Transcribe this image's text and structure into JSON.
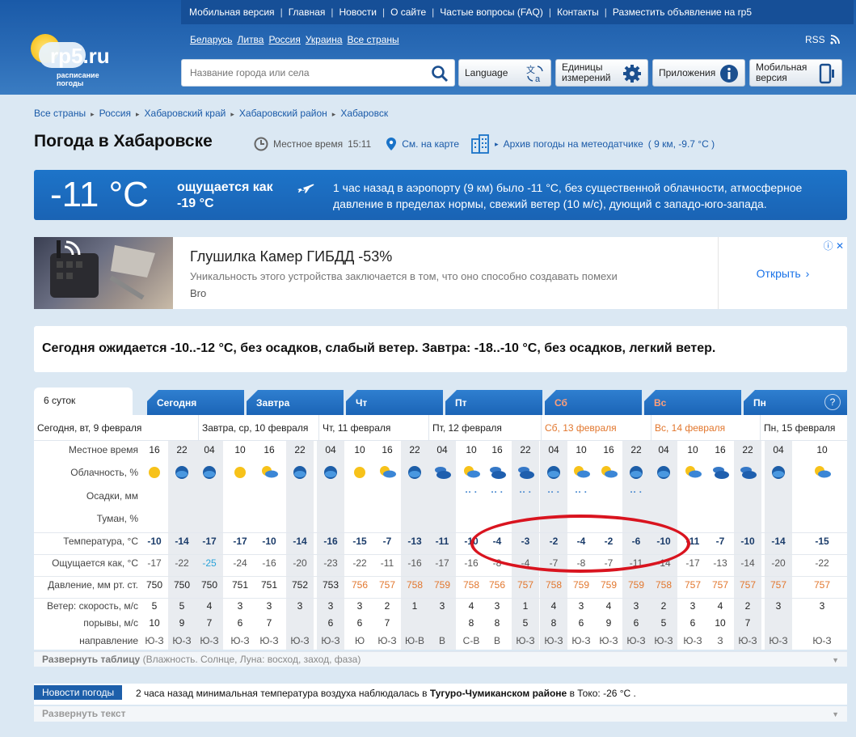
{
  "header": {
    "logo_name": "rp5.ru",
    "logo_sub": "расписание погоды",
    "nav": [
      "Мобильная версия",
      "Главная",
      "Новости",
      "О сайте",
      "Частые вопросы (FAQ)",
      "Контакты",
      "Разместить объявление на rp5"
    ],
    "countries": [
      "Беларусь",
      "Литва",
      "Россия",
      "Украина",
      "Все страны"
    ],
    "rss": "RSS",
    "search_placeholder": "Название города или села",
    "btn_language": "Language",
    "btn_units": "Единицы измерений",
    "btn_apps": "Приложения",
    "btn_mobile": "Мобильная версия"
  },
  "breadcrumbs": [
    "Все страны",
    "Россия",
    "Хабаровский край",
    "Хабаровский район",
    "Хабаровск"
  ],
  "page_title": "Погода в Хабаровске",
  "local_time_label": "Местное время",
  "local_time": "15:11",
  "map_link": "См. на карте",
  "archive_link": "Архив погоды на метеодатчике",
  "archive_note": "( 9 км, -9.7 °C )",
  "current": {
    "temp": "-11 °C",
    "feels": "ощущается как -19 °C",
    "desc": "1 час назад в аэропорту (9 км) было -11 °C, без существенной облачности, атмосферное давление в пределах нормы, свежий ветер (10 м/с), дующий с западо-юго-запада."
  },
  "ad": {
    "title": "Глушилка Камер ГИБДД -53%",
    "sub": "Уникальность этого устройства заключается в том, что оно способно создавать помехи",
    "source": "Bro",
    "open": "Открыть"
  },
  "forecast_text": "Сегодня ожидается -10..-12 °C, без осадков, слабый ветер. Завтра: -18..-10 °C, без осадков, легкий ветер.",
  "tabs": [
    {
      "label": "6 суток",
      "active": true,
      "weekend": false
    },
    {
      "label": "Сегодня",
      "active": false,
      "weekend": false
    },
    {
      "label": "Завтра",
      "active": false,
      "weekend": false
    },
    {
      "label": "Чт",
      "active": false,
      "weekend": false
    },
    {
      "label": "Пт",
      "active": false,
      "weekend": false
    },
    {
      "label": "Сб",
      "active": false,
      "weekend": true
    },
    {
      "label": "Вс",
      "active": false,
      "weekend": true
    },
    {
      "label": "Пн",
      "active": false,
      "weekend": false
    }
  ],
  "help": "?",
  "days": [
    {
      "label": "Сегодня, вт, 9 февраля",
      "cols": 2,
      "weekend": false
    },
    {
      "label": "Завтра, ср, 10 февраля",
      "cols": 4,
      "weekend": false
    },
    {
      "label": "Чт, 11 февраля",
      "cols": 4,
      "weekend": false
    },
    {
      "label": "Пт, 12 февраля",
      "cols": 4,
      "weekend": false
    },
    {
      "label": "Сб, 13 февраля",
      "cols": 4,
      "weekend": true
    },
    {
      "label": "Вс, 14 февраля",
      "cols": 4,
      "weekend": true
    },
    {
      "label": "Пн, 15 февраля",
      "cols": 2,
      "weekend": false
    }
  ],
  "row_labels": [
    "Местное время",
    "Облачность, %",
    "Осадки, мм",
    "Туман, %",
    "Температура, °С",
    "Ощущается как, °С",
    "Давление, мм рт. ст.",
    "Ветер: скорость, м/с",
    "порывы, м/с",
    "направление"
  ],
  "hours": [
    "16",
    "22",
    "04",
    "10",
    "16",
    "22",
    "04",
    "10",
    "16",
    "22",
    "04",
    "10",
    "16",
    "22",
    "04",
    "10",
    "16",
    "22",
    "04",
    "10",
    "16",
    "22",
    "04",
    "10"
  ],
  "cloud_icons": [
    "sun",
    "night-cloud",
    "night-cloud",
    "sun",
    "sun-cloud",
    "night-cloud",
    "night-cloud",
    "sun",
    "sun-cloud",
    "night-cloud",
    "clouds",
    "sun-cloud",
    "clouds",
    "clouds",
    "night-cloud",
    "sun-cloud",
    "sun-cloud",
    "night-cloud",
    "night-cloud",
    "sun-cloud",
    "clouds",
    "clouds",
    "night-cloud",
    "sun-cloud"
  ],
  "precip_marks": [
    0,
    0,
    0,
    0,
    0,
    0,
    0,
    0,
    0,
    0,
    0,
    1,
    1,
    1,
    1,
    1,
    0,
    1,
    0,
    0,
    0,
    0,
    0,
    0
  ],
  "temperature": [
    "-10",
    "-14",
    "-17",
    "-17",
    "-10",
    "-14",
    "-16",
    "-15",
    "-7",
    "-13",
    "-11",
    "-10",
    "-4",
    "-3",
    "-2",
    "-4",
    "-2",
    "-6",
    "-10",
    "-11",
    "-7",
    "-10",
    "-14",
    "-15"
  ],
  "feels_like": [
    "-17",
    "-22",
    "-25",
    "-24",
    "-16",
    "-20",
    "-23",
    "-22",
    "-11",
    "-16",
    "-17",
    "-16",
    "-8",
    "-4",
    "-7",
    "-8",
    "-7",
    "-11",
    "-14",
    "-17",
    "-13",
    "-14",
    "-20",
    "-22"
  ],
  "pressure": [
    "750",
    "750",
    "750",
    "751",
    "751",
    "752",
    "753",
    "756",
    "757",
    "758",
    "759",
    "758",
    "756",
    "757",
    "758",
    "759",
    "759",
    "759",
    "758",
    "757",
    "757",
    "757",
    "757",
    "757"
  ],
  "wind_speed": [
    "5",
    "5",
    "4",
    "3",
    "3",
    "3",
    "3",
    "3",
    "2",
    "1",
    "3",
    "4",
    "3",
    "1",
    "4",
    "3",
    "4",
    "3",
    "2",
    "3",
    "4",
    "2",
    "3",
    "3"
  ],
  "gusts": [
    "10",
    "9",
    "7",
    "6",
    "7",
    "",
    "6",
    "6",
    "7",
    "",
    "",
    "8",
    "8",
    "5",
    "8",
    "6",
    "9",
    "6",
    "5",
    "6",
    "10",
    "7",
    "",
    ""
  ],
  "direction": [
    "Ю-З",
    "Ю-З",
    "Ю-З",
    "Ю-З",
    "Ю-З",
    "Ю-З",
    "Ю-З",
    "Ю",
    "Ю-З",
    "Ю-В",
    "В",
    "С-В",
    "В",
    "Ю-З",
    "Ю-З",
    "Ю-З",
    "Ю-З",
    "Ю-З",
    "Ю-З",
    "Ю-З",
    "З",
    "Ю-З",
    "Ю-З",
    "Ю-З"
  ],
  "expand_table_label": "Развернуть таблицу",
  "expand_table_note": "(Влажность. Солнце, Луна: восход, заход, фаза)",
  "news_tag": "Новости погоды",
  "news_prefix": "2 часа назад минимальная температура воздуха наблюдалась в ",
  "news_place": "Тугуро-Чумиканском районе",
  "news_suffix": " в Токо: -26 °C .",
  "expand_text_label": "Развернуть текст",
  "colors": {
    "accent": "#1a63b4",
    "weekend": "#e2772e",
    "annotation": "#d9141f",
    "cold": "#2ba3d9"
  }
}
